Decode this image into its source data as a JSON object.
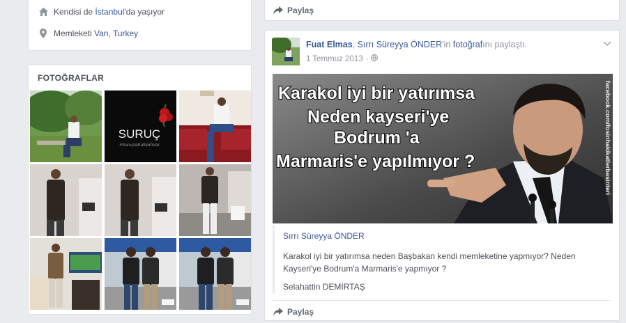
{
  "intro": {
    "lives_prefix": "Kendisi de ",
    "lives_city": "İstanbul",
    "lives_suffix": "'da yaşıyor",
    "home_prefix": "Memleketi ",
    "home_city": "Van",
    "home_sep": ", ",
    "home_country": "Turkey"
  },
  "photos": {
    "heading": "FOTOĞRAFLAR",
    "suruc_title": "SURUÇ",
    "suruc_tag": "#SuruçtaKatliamVar"
  },
  "share_label": "Paylaş",
  "post": {
    "author": "Fuat Elmas",
    "sep": ", ",
    "shared_from": "Sırrı Süreyya ÖNDER",
    "possessive": "'in ",
    "object": "fotoğraf",
    "action": "ını paylaştı.",
    "date": "1 Temmuz 2013",
    "dot": "·",
    "image_lines": [
      "Karakol iyi bir yatırımsa",
      "Neden kayseri'ye",
      "Bodrum 'a",
      "Marmaris'e yapılmıyor ?"
    ],
    "watermark": "facebook.com/fosinhakikatlerbasinteri",
    "quote_title": "Sırrı Süreyya ÖNDER",
    "quote_text": "Karakol iyi bir yatırımsa neden Başbakan kendi memleketine yapmıyor? Neden Kayseri'ye Bodrum'a Marmaris'e yapmıyor ?",
    "quote_sig": "Selahattin DEMİRTAŞ"
  }
}
